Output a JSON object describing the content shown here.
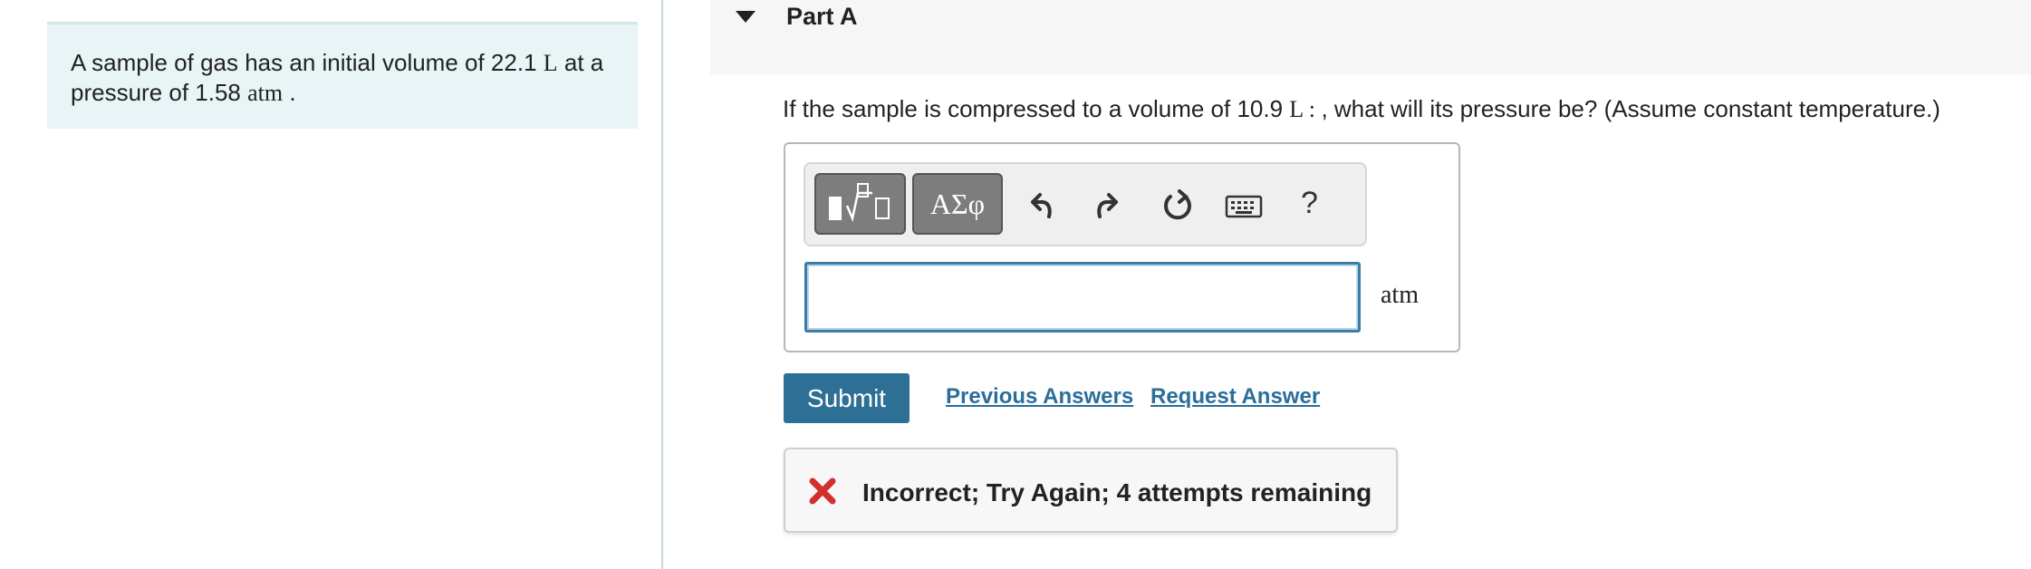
{
  "intro": {
    "line1_text": "A sample of gas has an initial volume of 22.1 ",
    "line1_unit": "L",
    "line1_end": " at a",
    "line2_text": "pressure of 1.58 ",
    "line2_unit": "atm",
    "line2_end": " ."
  },
  "part": {
    "title": "Part A",
    "question_pre": "If the sample is compressed to a volume of 10.9 ",
    "question_unit": "L",
    "question_colon": " : ",
    "question_post": ", what will its pressure be? (Assume constant temperature.)"
  },
  "toolbar": {
    "templates_icon": "templates-icon",
    "greek_label": "ΑΣφ",
    "undo_icon": "undo-icon",
    "redo_icon": "redo-icon",
    "reset_icon": "reset-icon",
    "keyboard_icon": "keyboard-icon",
    "help_label": "?"
  },
  "answer": {
    "value": "",
    "unit": "atm"
  },
  "actions": {
    "submit_label": "Submit",
    "previous_answers_label": "Previous Answers",
    "request_answer_label": "Request Answer"
  },
  "feedback": {
    "icon": "x-icon",
    "message": "Incorrect; Try Again; 4 attempts remaining"
  },
  "colors": {
    "intro_bg": "#e8f4f6",
    "submit_bg": "#2e6f95",
    "link": "#2a6e9b",
    "error": "#d32f2f",
    "input_border": "#3a7ca5"
  }
}
